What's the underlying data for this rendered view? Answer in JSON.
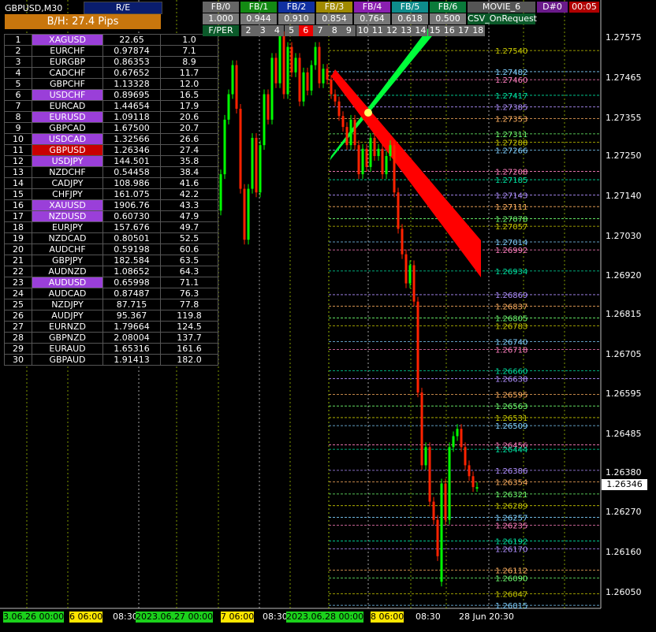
{
  "header": {
    "symbol": "GBPUSD,M30",
    "re_label": "R/E",
    "bh_label": "B/H: 27.4 Pips"
  },
  "pairs": [
    {
      "i": "1",
      "s": "XAGUSD",
      "p": "22.65",
      "v": "1.0",
      "hl": true
    },
    {
      "i": "2",
      "s": "EURCHF",
      "p": "0.97874",
      "v": "7.1",
      "hl": false
    },
    {
      "i": "3",
      "s": "EURGBP",
      "p": "0.86353",
      "v": "8.9",
      "hl": false
    },
    {
      "i": "4",
      "s": "CADCHF",
      "p": "0.67652",
      "v": "11.7",
      "hl": false
    },
    {
      "i": "5",
      "s": "GBPCHF",
      "p": "1.13328",
      "v": "12.0",
      "hl": false
    },
    {
      "i": "6",
      "s": "USDCHF",
      "p": "0.89695",
      "v": "16.5",
      "hl": true
    },
    {
      "i": "7",
      "s": "EURCAD",
      "p": "1.44654",
      "v": "17.9",
      "hl": false
    },
    {
      "i": "8",
      "s": "EURUSD",
      "p": "1.09118",
      "v": "20.6",
      "hl": true
    },
    {
      "i": "9",
      "s": "GBPCAD",
      "p": "1.67500",
      "v": "20.7",
      "hl": false
    },
    {
      "i": "10",
      "s": "USDCAD",
      "p": "1.32566",
      "v": "26.6",
      "hl": true
    },
    {
      "i": "11",
      "s": "GBPUSD",
      "p": "1.26346",
      "v": "27.4",
      "hl": false,
      "cur": true
    },
    {
      "i": "12",
      "s": "USDJPY",
      "p": "144.501",
      "v": "35.8",
      "hl": true
    },
    {
      "i": "13",
      "s": "NZDCHF",
      "p": "0.54458",
      "v": "38.4",
      "hl": false
    },
    {
      "i": "14",
      "s": "CADJPY",
      "p": "108.986",
      "v": "41.6",
      "hl": false
    },
    {
      "i": "15",
      "s": "CHFJPY",
      "p": "161.075",
      "v": "42.2",
      "hl": false
    },
    {
      "i": "16",
      "s": "XAUUSD",
      "p": "1906.76",
      "v": "43.3",
      "hl": true
    },
    {
      "i": "17",
      "s": "NZDUSD",
      "p": "0.60730",
      "v": "47.9",
      "hl": true
    },
    {
      "i": "18",
      "s": "EURJPY",
      "p": "157.676",
      "v": "49.7",
      "hl": false
    },
    {
      "i": "19",
      "s": "NZDCAD",
      "p": "0.80501",
      "v": "52.5",
      "hl": false
    },
    {
      "i": "20",
      "s": "AUDCHF",
      "p": "0.59198",
      "v": "60.6",
      "hl": false
    },
    {
      "i": "21",
      "s": "GBPJPY",
      "p": "182.584",
      "v": "63.5",
      "hl": false
    },
    {
      "i": "22",
      "s": "AUDNZD",
      "p": "1.08652",
      "v": "64.3",
      "hl": false
    },
    {
      "i": "23",
      "s": "AUDUSD",
      "p": "0.65998",
      "v": "71.1",
      "hl": true
    },
    {
      "i": "24",
      "s": "AUDCAD",
      "p": "0.87487",
      "v": "76.3",
      "hl": false
    },
    {
      "i": "25",
      "s": "NZDJPY",
      "p": "87.715",
      "v": "77.8",
      "hl": false
    },
    {
      "i": "26",
      "s": "AUDJPY",
      "p": "95.367",
      "v": "119.8",
      "hl": false
    },
    {
      "i": "27",
      "s": "EURNZD",
      "p": "1.79664",
      "v": "124.5",
      "hl": false
    },
    {
      "i": "28",
      "s": "GBPNZD",
      "p": "2.08004",
      "v": "137.7",
      "hl": false
    },
    {
      "i": "29",
      "s": "EURAUD",
      "p": "1.65316",
      "v": "161.6",
      "hl": false
    },
    {
      "i": "30",
      "s": "GBPAUD",
      "p": "1.91413",
      "v": "182.0",
      "hl": false
    }
  ],
  "fib_buttons": [
    {
      "label": "FB/0",
      "color": "#666666",
      "value": "1.000"
    },
    {
      "label": "FB/1",
      "color": "#138a13",
      "value": "0.944"
    },
    {
      "label": "FB/2",
      "color": "#1030a0",
      "value": "0.910"
    },
    {
      "label": "FB/3",
      "color": "#a08a00",
      "value": "0.854"
    },
    {
      "label": "FB/4",
      "color": "#8a1fb0",
      "value": "0.764"
    },
    {
      "label": "FB/5",
      "color": "#0e8c8c",
      "value": "0.618"
    },
    {
      "label": "FB/6",
      "color": "#0a7a3a",
      "value": "0.500"
    },
    {
      "label": "MOVIE_6",
      "color": "#555555",
      "value": "CSV_OnRequest"
    },
    {
      "label": "D#0",
      "color": "#6a1a8a",
      "value": ""
    },
    {
      "label": "00:05",
      "color": "#b00000",
      "value": ""
    }
  ],
  "periods": {
    "label": "F/PER",
    "cells": [
      "2",
      "3",
      "4",
      "5",
      "6",
      "7",
      "8",
      "9",
      "10",
      "11",
      "12",
      "13",
      "14",
      "15",
      "16",
      "17",
      "18"
    ],
    "selected": "6"
  },
  "price_axis": [
    "1.27575",
    "1.27465",
    "1.27355",
    "1.27250",
    "1.27140",
    "1.27030",
    "1.26920",
    "1.26815",
    "1.26705",
    "1.26595",
    "1.26485",
    "1.26380",
    "1.26270",
    "1.26160",
    "1.26050"
  ],
  "current_price": "1.26346",
  "time_axis": [
    {
      "label": "3.06.26 00:00",
      "style": "g"
    },
    {
      "label": "6 06:00",
      "style": "y"
    },
    {
      "label": "08:30",
      "style": ""
    },
    {
      "label": "2023.06.27 00:00",
      "style": "g"
    },
    {
      "label": "7 06:00",
      "style": "y"
    },
    {
      "label": "08:30",
      "style": ""
    },
    {
      "label": "2023.06.28 00:00",
      "style": "g"
    },
    {
      "label": "8 06:00",
      "style": "y"
    },
    {
      "label": "08:30",
      "style": ""
    },
    {
      "label": "28 Jun 20:30",
      "style": ""
    }
  ],
  "fib_levels": [
    "1.27540",
    "1.27482",
    "1.27460",
    "1.27417",
    "1.27385",
    "1.27353",
    "1.27311",
    "1.27288",
    "1.27266",
    "1.27208",
    "1.27185",
    "1.27143",
    "1.27111",
    "1.27078",
    "1.27057",
    "1.27014",
    "1.26992",
    "1.26934",
    "1.26869",
    "1.26837",
    "1.26805",
    "1.26783",
    "1.26740",
    "1.26718",
    "1.26660",
    "1.26638",
    "1.26595",
    "1.26563",
    "1.26531",
    "1.26509",
    "1.26456",
    "1.26444",
    "1.26386",
    "1.26354",
    "1.26321",
    "1.26289",
    "1.26257",
    "1.26235",
    "1.26192",
    "1.26170",
    "1.26112",
    "1.26090",
    "1.26047",
    "1.26015"
  ],
  "colors": {
    "bull": "#00ff00",
    "bear": "#ff2200",
    "fan_green": "#00ff3a",
    "fan_red": "#ff0000"
  }
}
